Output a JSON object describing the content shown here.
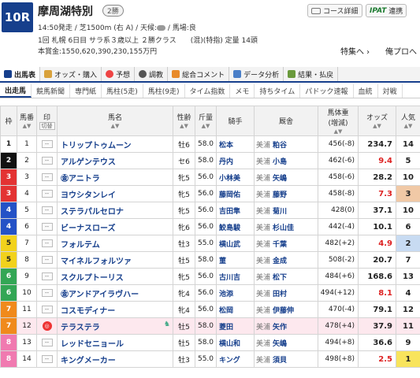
{
  "race": {
    "number": "10R",
    "name": "摩周湖特別",
    "grade": "2勝",
    "line1": "14:50発走 / 芝1500m (右 A) / 天候:",
    "line1b": " / 馬場:良",
    "line2": "1回 札幌 6日目 サラ系３歳以上 ２勝クラス　　(混)(特指) 定量 14頭",
    "line3": "本賞金:1550,620,390,230,155万円"
  },
  "top_buttons": {
    "course": "コース詳細",
    "ipat_logo": "IPAT",
    "ipat_label": "連携"
  },
  "links": {
    "feature": "特集へ ›",
    "pro": "俺プロへ ›"
  },
  "tabs": [
    "出馬表",
    "オッズ・購入",
    "予想",
    "調教",
    "総合コメント",
    "データ分析",
    "結果・払戻"
  ],
  "subtabs": [
    "出走馬",
    "競馬新聞",
    "専門紙",
    "馬柱(5走)",
    "馬柱(9走)",
    "タイム指数",
    "メモ",
    "持ちタイム",
    "パドック速報",
    "血統",
    "対戦"
  ],
  "headers": {
    "waku": "枠",
    "umaban": "馬番",
    "mark": "印",
    "mark_sub": "切替",
    "horse": "馬名",
    "sexage": "性齢",
    "kin": "斤量",
    "jockey": "騎手",
    "trainer": "厩舎",
    "weight": "馬体重",
    "weight_sub": "(増減)",
    "odds": "オッズ",
    "pop": "人気"
  },
  "rows": [
    {
      "waku": "1",
      "num": "1",
      "horse": "トリップトゥムーン",
      "sex": "牡6",
      "kin": "58.0",
      "jockey": "松本",
      "region": "美浦",
      "trainer": "粕谷",
      "weight": "456(-8)",
      "odds": "234.7",
      "pop": "14"
    },
    {
      "waku": "2",
      "num": "2",
      "horse": "アルゲンテウス",
      "sex": "セ6",
      "kin": "58.0",
      "jockey": "丹内",
      "region": "美浦",
      "trainer": "小島",
      "weight": "462(-6)",
      "odds": "9.4",
      "pop": "5"
    },
    {
      "waku": "3",
      "num": "3",
      "horse": "アニトラ",
      "sex": "牝5",
      "kin": "56.0",
      "jockey": "小林美",
      "region": "美浦",
      "trainer": "矢嶋",
      "weight": "458(-6)",
      "odds": "28.2",
      "pop": "10",
      "prefix": "㊎"
    },
    {
      "waku": "3",
      "num": "4",
      "horse": "ヨウシタンレイ",
      "sex": "牝5",
      "kin": "56.0",
      "jockey": "藤岡佑",
      "region": "美浦",
      "trainer": "藤野",
      "weight": "458(-8)",
      "odds": "7.3",
      "pop": "3"
    },
    {
      "waku": "4",
      "num": "5",
      "horse": "ステラパルセロナ",
      "sex": "牝5",
      "kin": "56.0",
      "jockey": "吉田隼",
      "region": "美浦",
      "trainer": "菊川",
      "weight": "428(0)",
      "odds": "37.1",
      "pop": "10"
    },
    {
      "waku": "4",
      "num": "6",
      "horse": "ビーナスローズ",
      "sex": "牝6",
      "kin": "56.0",
      "jockey": "鮫島駿",
      "region": "美浦",
      "trainer": "杉山佳",
      "weight": "442(-4)",
      "odds": "10.1",
      "pop": "6"
    },
    {
      "waku": "5",
      "num": "7",
      "horse": "フォルテム",
      "sex": "牡3",
      "kin": "55.0",
      "jockey": "横山武",
      "region": "美浦",
      "trainer": "千葉",
      "weight": "482(+2)",
      "odds": "4.9",
      "pop": "2"
    },
    {
      "waku": "5",
      "num": "8",
      "horse": "マイネルフォルツァ",
      "sex": "牡5",
      "kin": "58.0",
      "jockey": "菫",
      "region": "美浦",
      "trainer": "金成",
      "weight": "508(-2)",
      "odds": "20.7",
      "pop": "7"
    },
    {
      "waku": "6",
      "num": "9",
      "horse": "スクルプトーリス",
      "sex": "牝5",
      "kin": "56.0",
      "jockey": "古川吉",
      "region": "美浦",
      "trainer": "松下",
      "weight": "484(+6)",
      "odds": "168.6",
      "pop": "13"
    },
    {
      "waku": "6",
      "num": "10",
      "horse": "アンドアイラヴハー",
      "sex": "牝4",
      "kin": "56.0",
      "jockey": "池添",
      "region": "美浦",
      "trainer": "田村",
      "weight": "494(+12)",
      "odds": "8.1",
      "pop": "4",
      "prefix": "㊎"
    },
    {
      "waku": "7",
      "num": "11",
      "horse": "コスモディナー",
      "sex": "牝4",
      "kin": "56.0",
      "jockey": "松岡",
      "region": "美浦",
      "trainer": "伊藤伸",
      "weight": "470(-4)",
      "odds": "79.1",
      "pop": "12"
    },
    {
      "waku": "7",
      "num": "12",
      "horse": "テラステラ",
      "sex": "牡5",
      "kin": "58.0",
      "jockey": "菱田",
      "region": "美浦",
      "trainer": "矢作",
      "weight": "478(+4)",
      "odds": "37.9",
      "pop": "11",
      "highlight": true
    },
    {
      "waku": "8",
      "num": "13",
      "horse": "レッドセニョール",
      "sex": "牡5",
      "kin": "58.0",
      "jockey": "横山和",
      "region": "美浦",
      "trainer": "矢嶋",
      "weight": "494(+8)",
      "odds": "36.6",
      "pop": "9"
    },
    {
      "waku": "8",
      "num": "14",
      "horse": "キングメーカー",
      "sex": "牡3",
      "kin": "55.0",
      "jockey": "キング",
      "region": "美浦",
      "trainer": "須貝",
      "weight": "498(+8)",
      "odds": "2.5",
      "pop": "1"
    }
  ],
  "mark_placeholder": "--",
  "colors": {
    "waku1": "#ffffff",
    "waku2": "#111111",
    "waku3": "#e33333",
    "waku4": "#2452c6",
    "waku5": "#f2d21c",
    "waku6": "#33a655",
    "waku7": "#f08a1c",
    "waku8": "#f07ab0",
    "accent": "#163f8c"
  }
}
